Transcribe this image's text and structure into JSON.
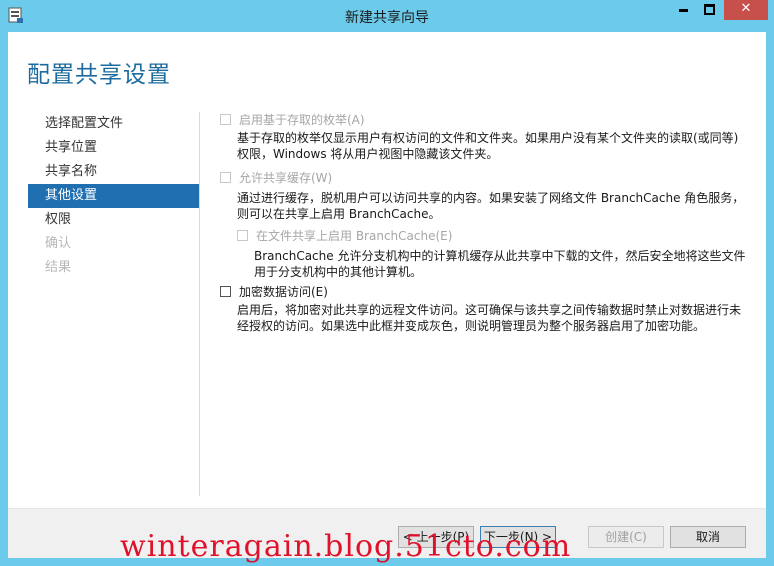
{
  "window": {
    "title": "新建共享向导",
    "controls": {
      "minimize": "minimize-icon",
      "maximize": "maximize-icon",
      "close_glyph": "✕"
    }
  },
  "page_title": "配置共享设置",
  "nav": {
    "items": [
      {
        "label": "选择配置文件",
        "state": "normal"
      },
      {
        "label": "共享位置",
        "state": "normal"
      },
      {
        "label": "共享名称",
        "state": "normal"
      },
      {
        "label": "其他设置",
        "state": "active"
      },
      {
        "label": "权限",
        "state": "normal"
      },
      {
        "label": "确认",
        "state": "disabled"
      },
      {
        "label": "结果",
        "state": "disabled"
      }
    ]
  },
  "options": {
    "abe": {
      "label": "启用基于存取的枚举(A)",
      "checked": false,
      "enabled": false,
      "desc1": "基于存取的枚举仅显示用户有权访问的文件和文件夹。如果用户没有某个文件夹的读取(或同等)",
      "desc2": "权限，Windows 将从用户视图中隐藏该文件夹。"
    },
    "caching": {
      "label": "允许共享缓存(W)",
      "checked": false,
      "enabled": false,
      "desc1": "通过进行缓存，脱机用户可以访问共享的内容。如果安装了网络文件 BranchCache 角色服务，",
      "desc2": "则可以在共享上启用 BranchCache。"
    },
    "branchcache": {
      "label": "在文件共享上启用 BranchCache(E)",
      "checked": false,
      "enabled": false,
      "desc1": "BranchCache 允许分支机构中的计算机缓存从此共享中下载的文件，然后安全地将这些文件",
      "desc2": "用于分支机构中的其他计算机。"
    },
    "encrypt": {
      "label": "加密数据访问(E)",
      "checked": false,
      "enabled": true,
      "desc1": "启用后，将加密对此共享的远程文件访问。这可确保与该共享之间传输数据时禁止对数据进行未",
      "desc2": "经授权的访问。如果选中此框并变成灰色，则说明管理员为整个服务器启用了加密功能。"
    }
  },
  "footer": {
    "prev": "< 上一步(P)",
    "next": "下一步(N) >",
    "create": "创建(C)",
    "cancel": "取消"
  },
  "watermark": "winteragain.blog.51cto.com",
  "colors": {
    "titlebar": "#6ccbea",
    "accent": "#1f6fb1",
    "page_title": "#1d6b9e",
    "close_button": "#c7504a",
    "watermark": "#e0112b"
  }
}
